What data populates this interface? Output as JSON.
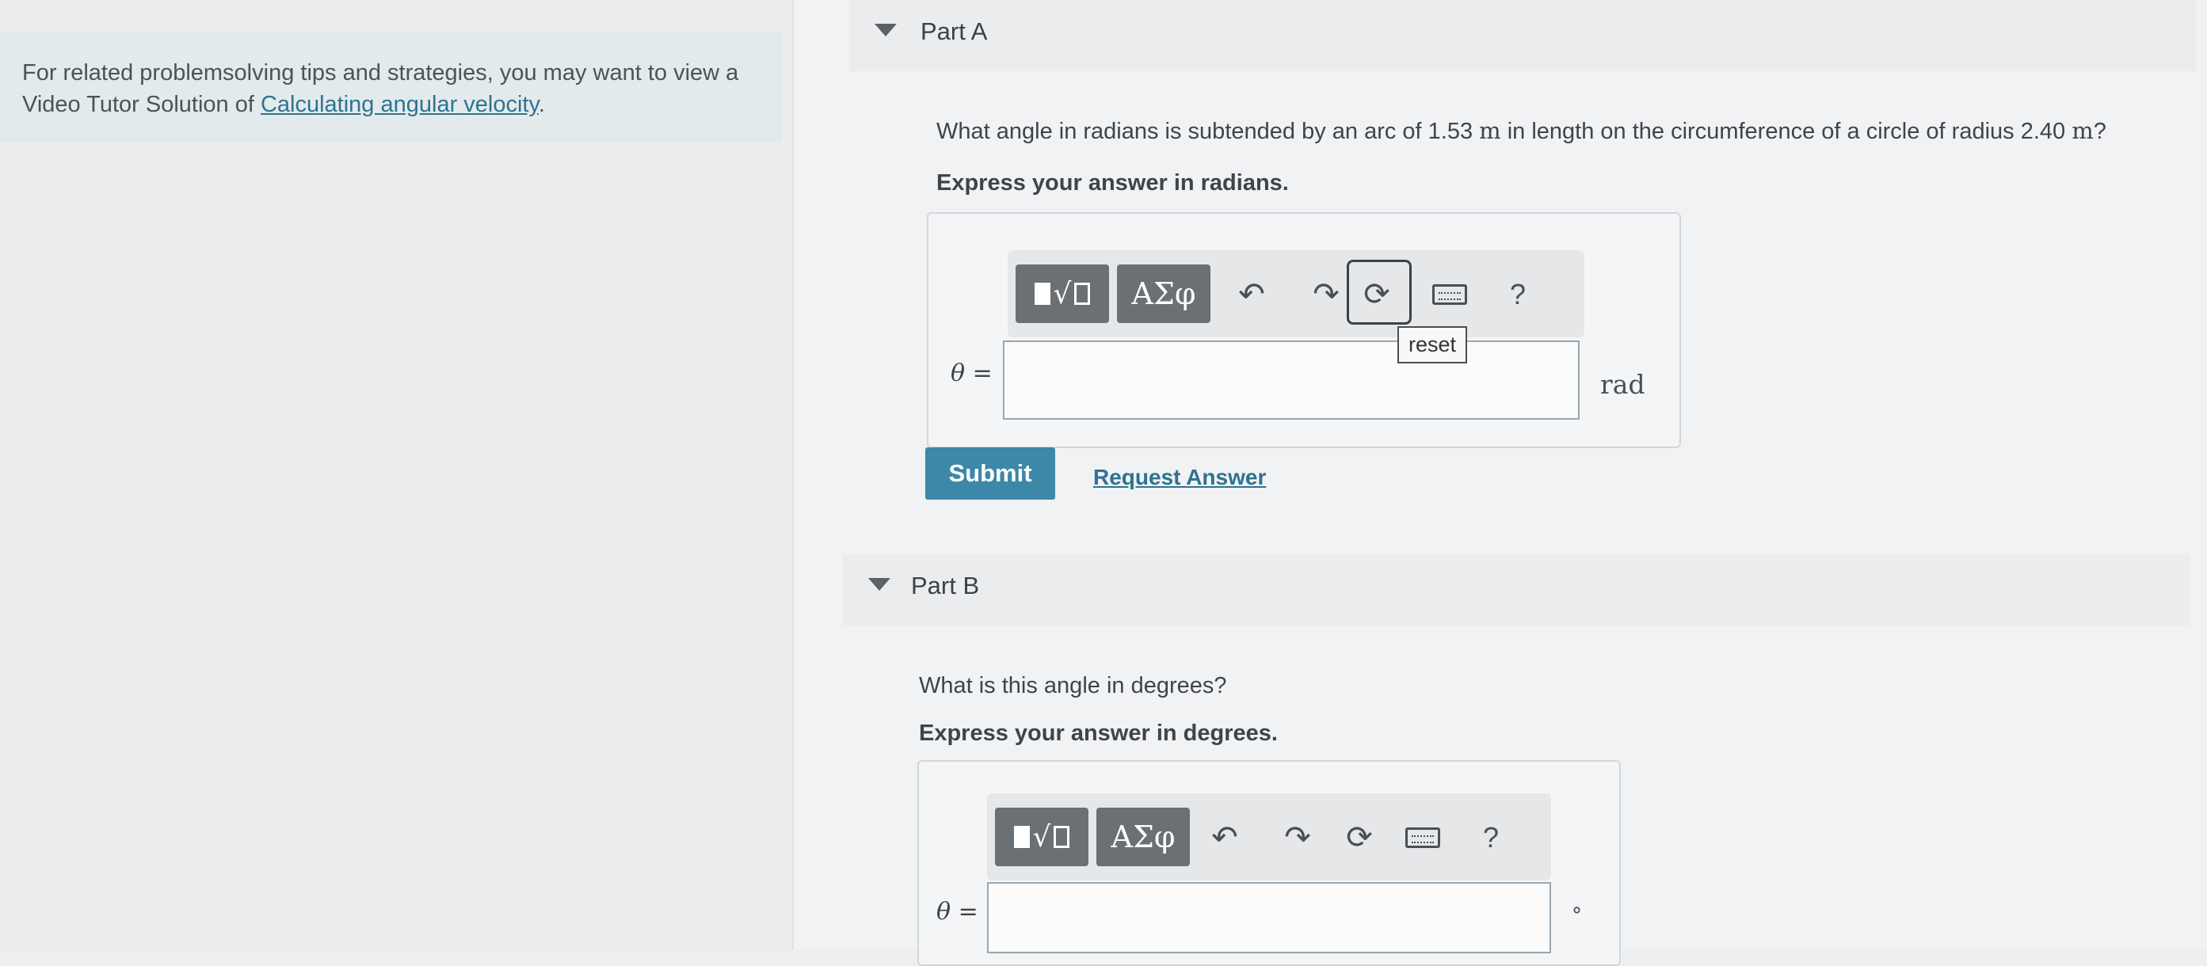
{
  "sidebar": {
    "tip_prefix": "For related problemsolving tips and strategies, you may want to view a Video Tutor Solution of ",
    "tip_link": "Calculating angular velocity",
    "tip_suffix": "."
  },
  "partA": {
    "title": "Part A",
    "question_1": "What angle in radians is subtended by an arc of 1.53 ",
    "unit_m": "m",
    "question_2": " in length on the circumference of a circle of radius 2.40 ",
    "question_end": "?",
    "instruction": "Express your answer in radians.",
    "toolbar": {
      "templates_icon": "fraction-root-icon",
      "greek_label": "ΑΣφ",
      "undo_icon": "undo-icon",
      "redo_icon": "redo-icon",
      "reset_icon": "reset-icon",
      "keyboard_icon": "keyboard-icon",
      "help_label": "?"
    },
    "tooltip": "reset",
    "variable_label": "θ",
    "equals": " =",
    "input_value": "",
    "unit": "rad",
    "submit_label": "Submit",
    "request_label": "Request Answer"
  },
  "partB": {
    "title": "Part B",
    "question": "What is this angle in degrees?",
    "instruction": "Express your answer in degrees.",
    "toolbar": {
      "greek_label": "ΑΣφ",
      "help_label": "?"
    },
    "variable_label": "θ",
    "equals": " =",
    "input_value": "",
    "unit": "°"
  },
  "colors": {
    "accent": "#3d87a8",
    "link": "#2e7391",
    "toolbar_dark": "#6b7075"
  }
}
